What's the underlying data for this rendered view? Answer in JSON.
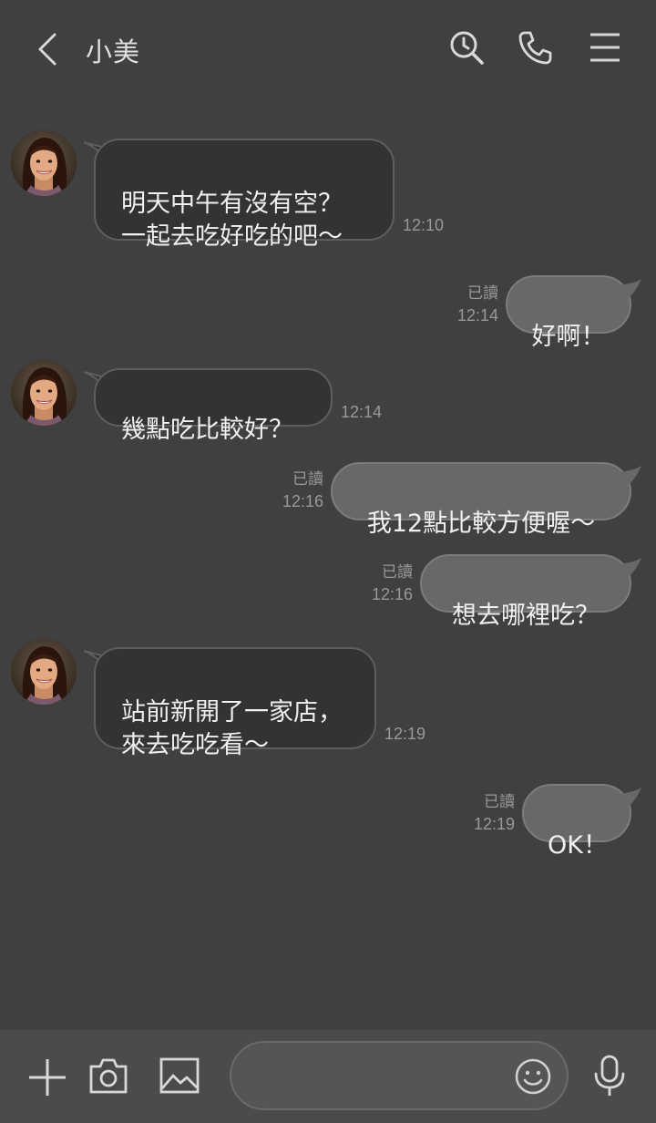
{
  "header": {
    "contact_name": "小美",
    "icons": [
      "back-chevron-icon",
      "search-clock-icon",
      "phone-icon",
      "menu-icon"
    ]
  },
  "messages": [
    {
      "direction": "incoming",
      "text": "明天中午有沒有空？\n一起去吃好吃的吧～",
      "time": "12:10"
    },
    {
      "direction": "outgoing",
      "text": "好啊！",
      "read": "已讀",
      "time": "12:14"
    },
    {
      "direction": "incoming",
      "text": "幾點吃比較好？",
      "time": "12:14"
    },
    {
      "direction": "outgoing",
      "text": "我12點比較方便喔～",
      "read": "已讀",
      "time": "12:16"
    },
    {
      "direction": "outgoing",
      "text": "想去哪裡吃？",
      "read": "已讀",
      "time": "12:16"
    },
    {
      "direction": "incoming",
      "text": "站前新開了一家店，\n來去吃吃看～",
      "time": "12:19"
    },
    {
      "direction": "outgoing",
      "text": "OK！",
      "read": "已讀",
      "time": "12:19"
    }
  ],
  "input": {
    "value": "",
    "placeholder": "",
    "icons": [
      "plus-icon",
      "camera-icon",
      "image-icon",
      "emoji-icon",
      "microphone-icon"
    ]
  },
  "colors": {
    "background": "#404040",
    "incoming_bubble": "#333333",
    "outgoing_bubble": "#686868",
    "bottom_bar": "#4b4b4b",
    "meta_text": "#999999"
  }
}
